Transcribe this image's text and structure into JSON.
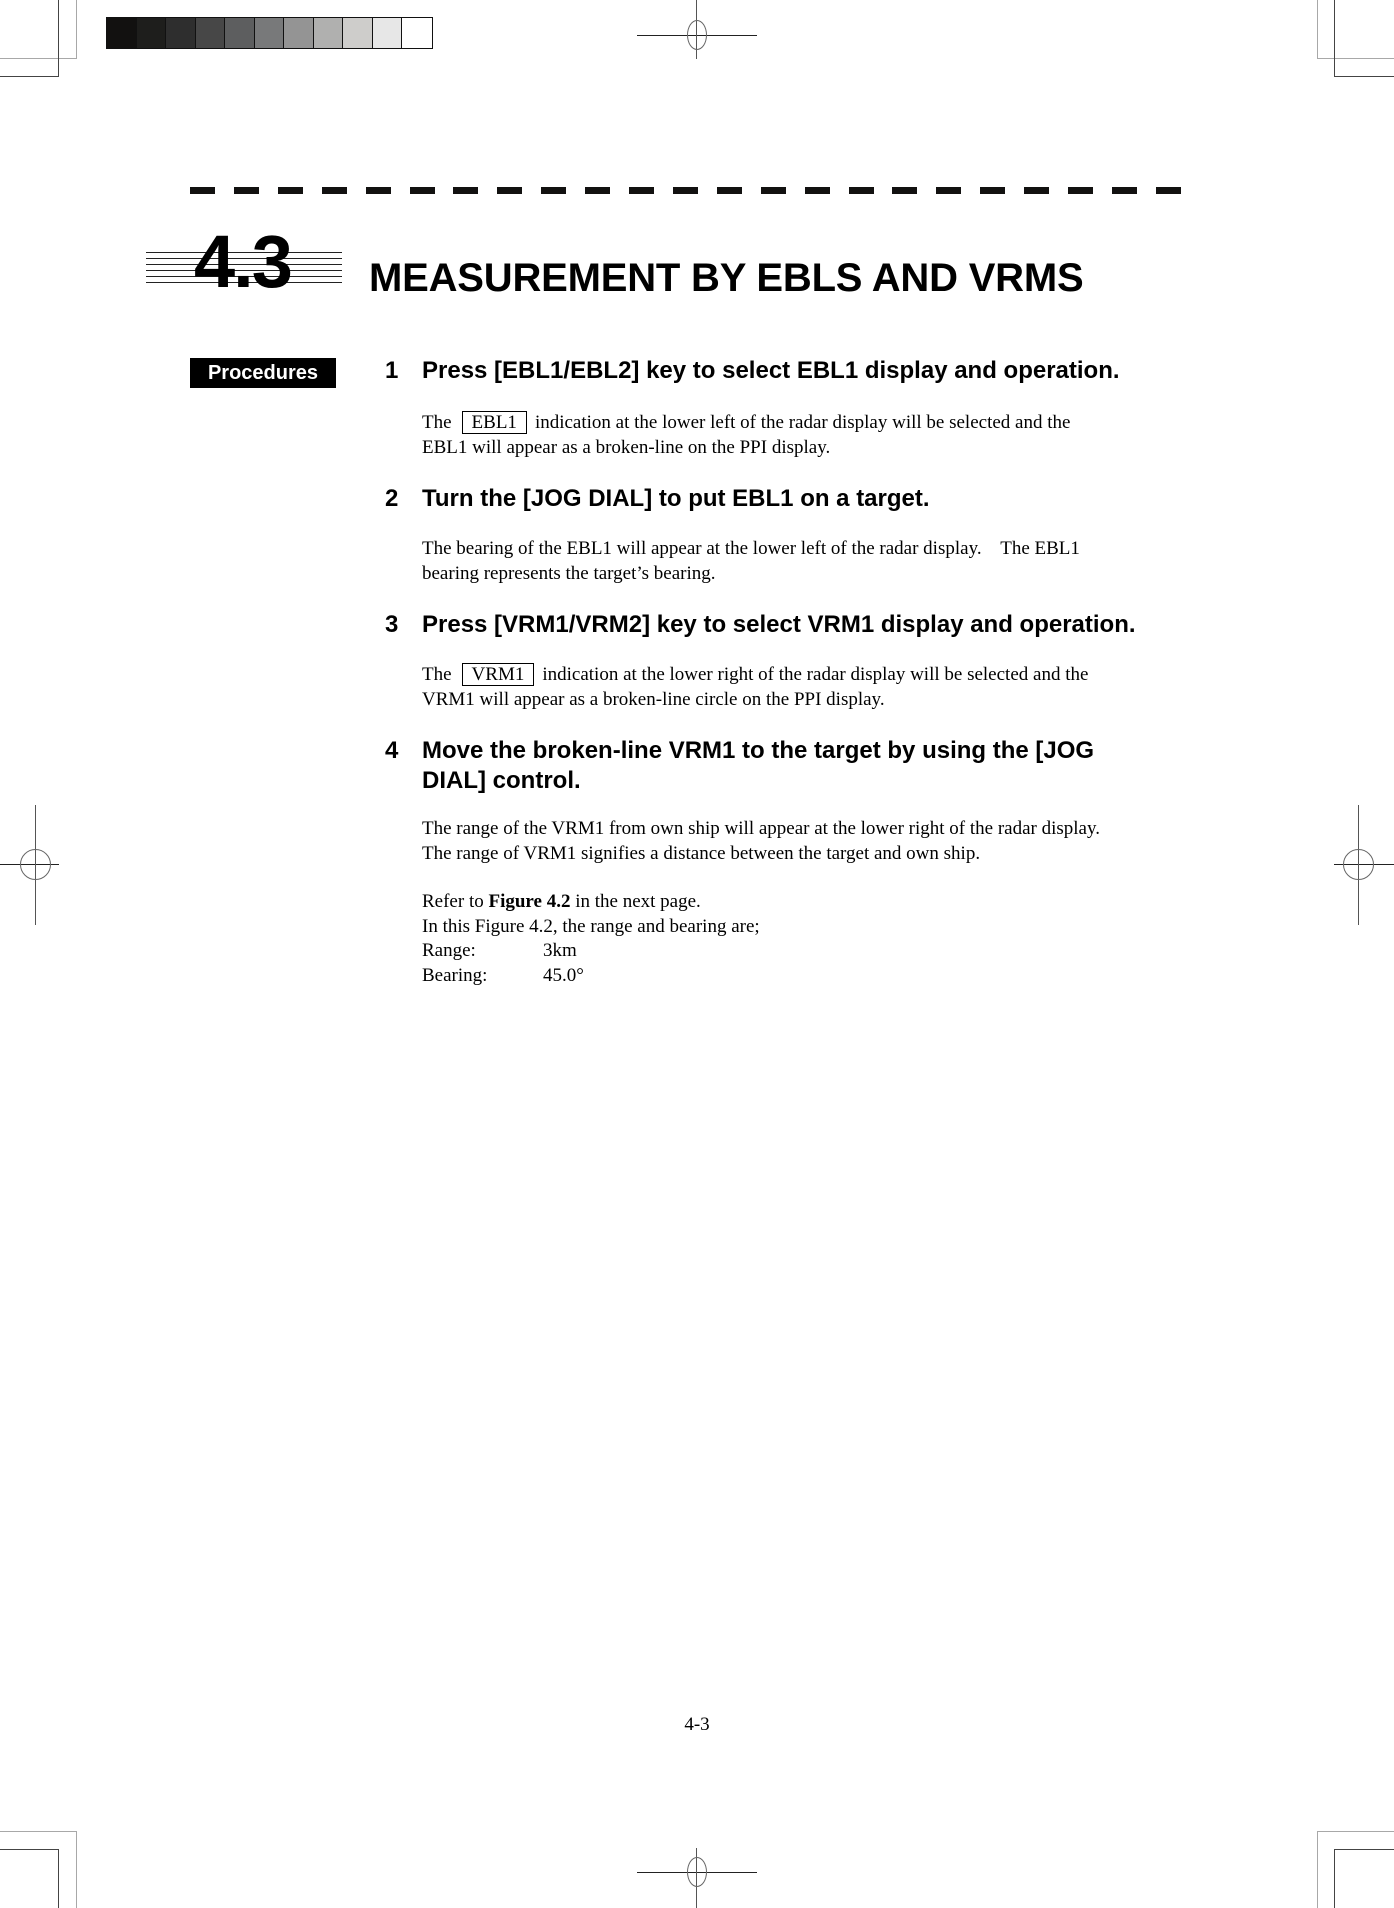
{
  "print_marks": {
    "color_bar_shades": [
      "#121110",
      "#1e1e1c",
      "#2e2e2e",
      "#474747",
      "#5d5e5f",
      "#78797a",
      "#949494",
      "#b0b0af",
      "#cecdcb",
      "#e7e7e7",
      "#ffffff"
    ]
  },
  "section": {
    "number": "4.3",
    "title": "MEASUREMENT BY EBLS AND VRMS"
  },
  "procedures_badge": "Procedures",
  "steps": [
    {
      "number": "1",
      "heading": "Press [EBL1/EBL2] key to select EBL1 display and operation.",
      "body": {
        "prefix": "The",
        "boxed": "EBL1",
        "line1_rest": "indication at the lower left of the radar display will be selected and the",
        "line2": "EBL1 will appear as a broken-line on the PPI display."
      }
    },
    {
      "number": "2",
      "heading": "Turn the [JOG DIAL] to put EBL1 on a target.",
      "body": {
        "line1": "The bearing of the EBL1 will appear at the lower left of the radar display.    The EBL1",
        "line2": "bearing represents the target’s bearing."
      }
    },
    {
      "number": "3",
      "heading": "Press [VRM1/VRM2] key to select VRM1 display and operation.",
      "body": {
        "prefix": "The",
        "boxed": "VRM1",
        "line1_rest": "indication at the lower right of the radar display will be selected and the",
        "line2": "VRM1 will appear as a broken-line circle on the PPI display."
      }
    },
    {
      "number": "4",
      "heading_line1": "Move the broken-line VRM1 to the target by using the [JOG",
      "heading_line2": "DIAL] control.",
      "body": {
        "line1": "The range of the VRM1 from own ship will appear at the lower right of the radar display.",
        "line2": "The range of VRM1 signifies a distance between the target and own ship.",
        "refer_prefix": "Refer to ",
        "refer_bold": "Figure 4.2",
        "refer_suffix": " in the next page.",
        "intro": "In this Figure 4.2, the range and bearing are;",
        "values": [
          {
            "label": "Range:",
            "value": "3km"
          },
          {
            "label": "Bearing:",
            "value": "45.0°"
          }
        ]
      }
    }
  ],
  "page_number": "4-3"
}
